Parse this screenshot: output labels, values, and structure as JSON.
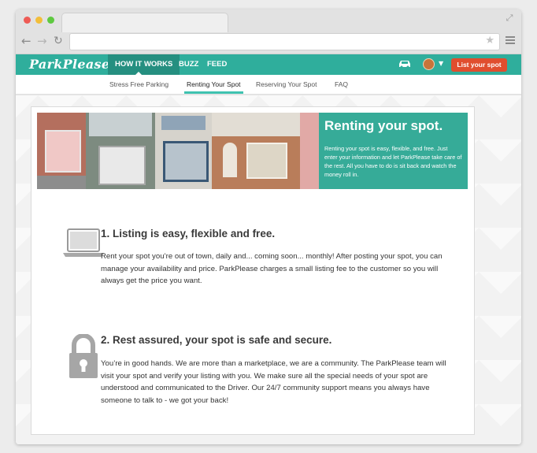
{
  "nav": {
    "logo": "ParkPlease",
    "items": [
      "HOW IT WORKS",
      "BUZZ",
      "FEED"
    ],
    "list_button": "List your spot",
    "icons": [
      "car-icon",
      "avatar",
      "chevron-down-icon"
    ]
  },
  "subnav": {
    "items": [
      "Stress Free Parking",
      "Renting Your Spot",
      "Reserving Your Spot",
      "FAQ"
    ],
    "active": "Renting Your Spot"
  },
  "hero": {
    "title": "Renting your spot.",
    "text": "Renting your spot is easy, flexible, and free. Just enter your information and let ParkPlease take care of the rest. All  you have to do is sit back and watch the money roll in."
  },
  "sections": [
    {
      "title": "1. Listing is easy, flexible and free.",
      "body": "Rent your spot you’re out of town, daily and... coming soon... monthly! After posting your spot, you can manage your availability and price. ParkPlease charges a small listing fee to the customer so you will always get the price you want.",
      "icon": "laptop-icon"
    },
    {
      "title": "2. Rest assured, your spot is safe and secure.",
      "body": "You’re in good hands. We are more than a marketplace, we are a community. The ParkPlease team will visit your spot and verify your listing with you. We make sure all the special needs of your spot are understood and communicated to the Driver. Our 24/7 community support means you always have someone to talk to - we got your back!",
      "icon": "lock-icon"
    }
  ],
  "colors": {
    "brand": "#2fae9c",
    "accent": "#e04e2e",
    "active_underline": "#3fc2b0"
  }
}
